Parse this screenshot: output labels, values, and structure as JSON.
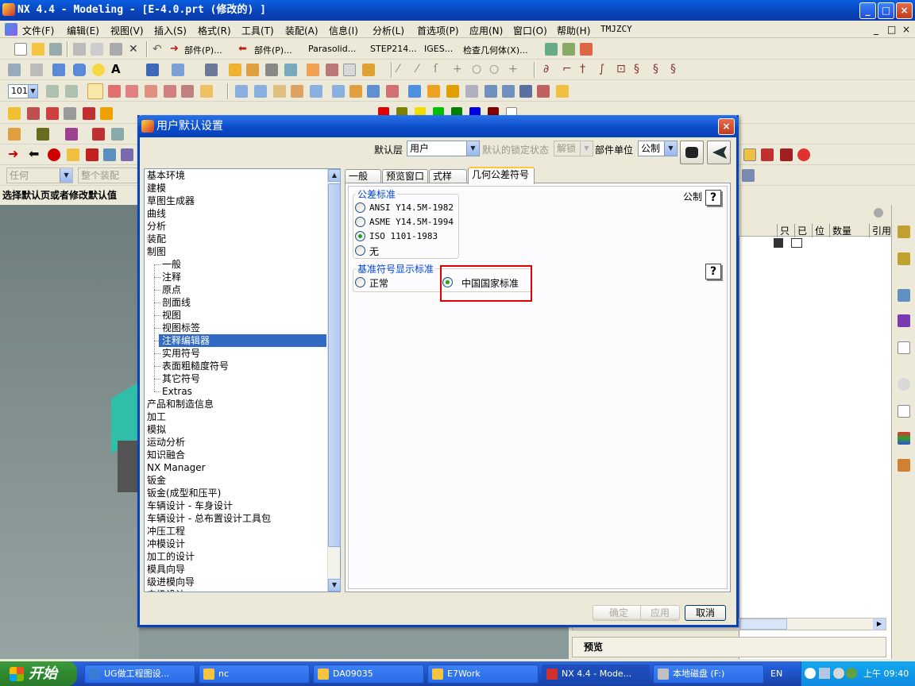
{
  "window": {
    "title": "NX 4.4 - Modeling - [E-4.0.prt (修改的) ]",
    "min": "_",
    "max": "□",
    "close": "×"
  },
  "menubar": {
    "items": [
      "文件(F)",
      "编辑(E)",
      "视图(V)",
      "插入(S)",
      "格式(R)",
      "工具(T)",
      "装配(A)",
      "信息(I)",
      "分析(L)",
      "首选项(P)",
      "应用(N)",
      "窗口(O)",
      "帮助(H)",
      "TMJZCY"
    ],
    "doc_min": "_",
    "doc_restore": "□",
    "doc_close": "×"
  },
  "toolbar1": {
    "part_prev": "部件(P)...",
    "part_next": "部件(P)...",
    "parasolid": "Parasolid...",
    "step": "STEP214...",
    "iges": "IGES...",
    "check_geom": "检查几何体(X)..."
  },
  "toolbar3": {
    "zoom_value": "101"
  },
  "filterbar": {
    "type_filter": "任何",
    "assembly_filter": "整个装配"
  },
  "statusline": {
    "text": "选择默认页或者修改默认值"
  },
  "navigator": {
    "columns": [
      "只",
      "已",
      "位",
      "数量",
      "引用"
    ]
  },
  "preview": {
    "label": "预览"
  },
  "dialog": {
    "title": "用户默认设置",
    "close": "×",
    "level_label": "默认层",
    "level_value": "用户",
    "lock_label": "默认的锁定状态",
    "lock_value": "解锁",
    "unit_label": "部件单位",
    "unit_value": "公制",
    "tree": {
      "items": [
        {
          "label": "基本环境",
          "child": false
        },
        {
          "label": "建模",
          "child": false
        },
        {
          "label": "草图生成器",
          "child": false
        },
        {
          "label": "曲线",
          "child": false
        },
        {
          "label": "分析",
          "child": false
        },
        {
          "label": "装配",
          "child": false
        },
        {
          "label": "制图",
          "child": false
        },
        {
          "label": "一般",
          "child": true
        },
        {
          "label": "注释",
          "child": true
        },
        {
          "label": "原点",
          "child": true
        },
        {
          "label": "剖面线",
          "child": true
        },
        {
          "label": "视图",
          "child": true
        },
        {
          "label": "视图标签",
          "child": true
        },
        {
          "label": "注释编辑器",
          "child": true,
          "selected": true
        },
        {
          "label": "实用符号",
          "child": true
        },
        {
          "label": "表面粗糙度符号",
          "child": true
        },
        {
          "label": "其它符号",
          "child": true
        },
        {
          "label": "Extras",
          "child": true
        },
        {
          "label": "产品和制造信息",
          "child": false
        },
        {
          "label": "加工",
          "child": false
        },
        {
          "label": "模拟",
          "child": false
        },
        {
          "label": "运动分析",
          "child": false
        },
        {
          "label": "知识融合",
          "child": false
        },
        {
          "label": "NX Manager",
          "child": false
        },
        {
          "label": "钣金",
          "child": false
        },
        {
          "label": "钣金(成型和压平)",
          "child": false
        },
        {
          "label": "车辆设计 - 车身设计",
          "child": false
        },
        {
          "label": "车辆设计 - 总布置设计工具包",
          "child": false
        },
        {
          "label": "冲压工程",
          "child": false
        },
        {
          "label": "冲模设计",
          "child": false
        },
        {
          "label": "加工的设计",
          "child": false
        },
        {
          "label": "模具向导",
          "child": false
        },
        {
          "label": "级进模向导",
          "child": false
        },
        {
          "label": "电极设计",
          "child": false
        }
      ]
    },
    "tabs": [
      "一般",
      "预览窗口",
      "式样",
      "几何公差符号"
    ],
    "active_tab": 3,
    "unit_note": "公制",
    "tolerance_group": {
      "title": "公差标准",
      "options": [
        "ANSI Y14.5M-1982",
        "ASME Y14.5M-1994",
        "ISO 1101-1983",
        "无"
      ],
      "selected": 2
    },
    "datum_group": {
      "title": "基准符号显示标准",
      "options": [
        "正常",
        "中国国家标准"
      ],
      "selected": 1
    },
    "help_glyph": "?",
    "buttons": {
      "ok": "确定",
      "apply": "应用",
      "cancel": "取消"
    }
  },
  "taskbar": {
    "start": "开始",
    "items": [
      {
        "label": "UG做工程图设...",
        "color": "#3a7bd5"
      },
      {
        "label": "nc",
        "color": "#f5c542"
      },
      {
        "label": "DA09035",
        "color": "#f5c542"
      },
      {
        "label": "E7Work",
        "color": "#f5c542"
      },
      {
        "label": "NX 4.4 - Mode...",
        "color": "#d03030"
      },
      {
        "label": "本地磁盘 (F:)",
        "color": "#c0c0c0"
      }
    ],
    "lang": "EN",
    "clock": "上午 09:40"
  }
}
